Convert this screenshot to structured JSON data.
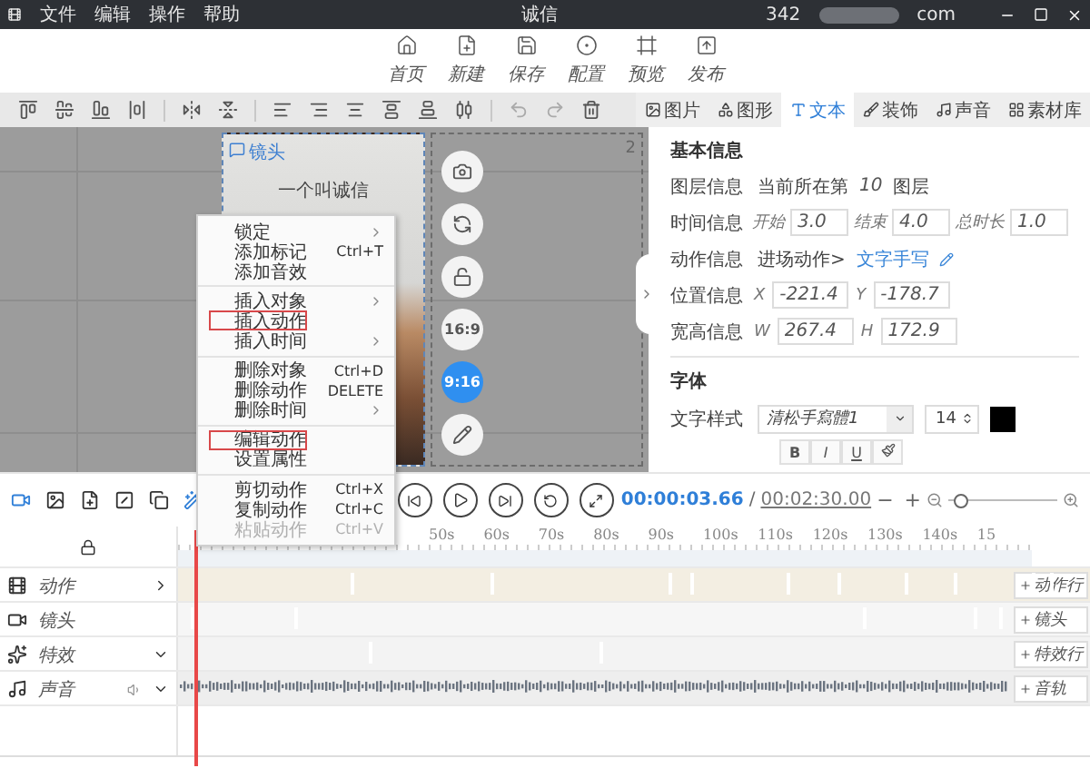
{
  "menu_bar": {
    "items": [
      "文件",
      "编辑",
      "操作",
      "帮助"
    ]
  },
  "window": {
    "title": "诚信",
    "account_start": "342",
    "account_end": "com"
  },
  "toolbar": [
    {
      "label": "首页"
    },
    {
      "label": "新建"
    },
    {
      "label": "保存"
    },
    {
      "label": "配置"
    },
    {
      "label": "预览"
    },
    {
      "label": "发布"
    }
  ],
  "panel_tabs": [
    {
      "label": "图片",
      "selected": false
    },
    {
      "label": "图形",
      "selected": false
    },
    {
      "label": "文本",
      "selected": true
    },
    {
      "label": "装饰",
      "selected": false
    },
    {
      "label": "声音",
      "selected": false
    },
    {
      "label": "素材库",
      "selected": false
    }
  ],
  "canvas": {
    "element_label": "镜头",
    "element_text": "一个叫诚信",
    "page_badge": "2",
    "side_buttons": [
      {
        "kind": "icon",
        "selected": false
      },
      {
        "kind": "icon",
        "selected": false
      },
      {
        "kind": "icon",
        "selected": false
      },
      {
        "kind": "ratio",
        "label": "16:9",
        "selected": false
      },
      {
        "kind": "ratio",
        "label": "9:16",
        "selected": true
      },
      {
        "kind": "icon",
        "selected": false
      }
    ]
  },
  "context_menu": [
    {
      "kind": "item",
      "label": "锁定",
      "submenu": true,
      "highlighted": false,
      "disabled": false
    },
    {
      "kind": "item",
      "label": "添加标记",
      "shortcut": "Ctrl+T",
      "submenu": false,
      "highlighted": false,
      "disabled": false
    },
    {
      "kind": "item",
      "label": "添加音效",
      "submenu": false,
      "highlighted": false,
      "disabled": false
    },
    {
      "kind": "divider"
    },
    {
      "kind": "item",
      "label": "插入对象",
      "submenu": true,
      "highlighted": false,
      "disabled": false
    },
    {
      "kind": "item",
      "label": "插入动作",
      "submenu": false,
      "highlighted": true,
      "disabled": false
    },
    {
      "kind": "item",
      "label": "插入时间",
      "submenu": true,
      "highlighted": false,
      "disabled": false
    },
    {
      "kind": "divider"
    },
    {
      "kind": "item",
      "label": "删除对象",
      "shortcut": "Ctrl+D",
      "submenu": false,
      "highlighted": false,
      "disabled": false
    },
    {
      "kind": "item",
      "label": "删除动作",
      "shortcut": "DELETE",
      "submenu": false,
      "highlighted": false,
      "disabled": false
    },
    {
      "kind": "item",
      "label": "删除时间",
      "submenu": true,
      "highlighted": false,
      "disabled": false
    },
    {
      "kind": "divider"
    },
    {
      "kind": "item",
      "label": "编辑动作",
      "submenu": false,
      "highlighted": true,
      "disabled": false
    },
    {
      "kind": "item",
      "label": "设置属性",
      "submenu": false,
      "highlighted": false,
      "disabled": false
    },
    {
      "kind": "divider"
    },
    {
      "kind": "item",
      "label": "剪切动作",
      "shortcut": "Ctrl+X",
      "submenu": false,
      "highlighted": false,
      "disabled": false
    },
    {
      "kind": "item",
      "label": "复制动作",
      "shortcut": "Ctrl+C",
      "submenu": false,
      "highlighted": false,
      "disabled": false
    },
    {
      "kind": "item",
      "label": "粘贴动作",
      "shortcut": "Ctrl+V",
      "submenu": false,
      "highlighted": false,
      "disabled": true
    }
  ],
  "properties": {
    "section_basic": "基本信息",
    "layer": {
      "label": "图层信息",
      "prefix": "当前所在第",
      "number": "10",
      "suffix": "图层"
    },
    "time": {
      "label": "时间信息",
      "fields": [
        {
          "name": "开始",
          "value": "3.0"
        },
        {
          "name": "结束",
          "value": "4.0"
        },
        {
          "name": "总时长",
          "value": "1.0"
        }
      ]
    },
    "action": {
      "label": "动作信息",
      "entry": "进场动作>",
      "effect": "文字手写"
    },
    "position": {
      "label": "位置信息",
      "fields": [
        {
          "name": "X",
          "value": "-221.4"
        },
        {
          "name": "Y",
          "value": "-178.7"
        }
      ]
    },
    "size": {
      "label": "宽高信息",
      "fields": [
        {
          "name": "W",
          "value": "267.4"
        },
        {
          "name": "H",
          "value": "172.9"
        }
      ]
    },
    "section_font": "字体",
    "font": {
      "label": "文字样式",
      "family": "清松手寫體1",
      "size": "14",
      "color": "#000000"
    },
    "styles": [
      "B",
      "I",
      "U"
    ]
  },
  "timeline": {
    "current_time": "00:00:03.66",
    "separator": "/",
    "total_time": "00:02:30.00",
    "minus": "−",
    "plus": "+",
    "zoom": {
      "level": 0.05
    },
    "ruler": [
      "50s",
      "60s",
      "70s",
      "80s",
      "90s",
      "100s",
      "110s",
      "120s",
      "130s",
      "140s",
      "15"
    ],
    "tracks": [
      {
        "label": "动作",
        "kind": "action",
        "expanded": false,
        "add_label": "动作行"
      },
      {
        "label": "镜头",
        "kind": "camera",
        "add_label": "镜头"
      },
      {
        "label": "特效",
        "kind": "effect",
        "expanded": true,
        "add_label": "特效行"
      },
      {
        "label": "声音",
        "kind": "sound",
        "expanded": true,
        "add_label": "音轨"
      }
    ]
  }
}
